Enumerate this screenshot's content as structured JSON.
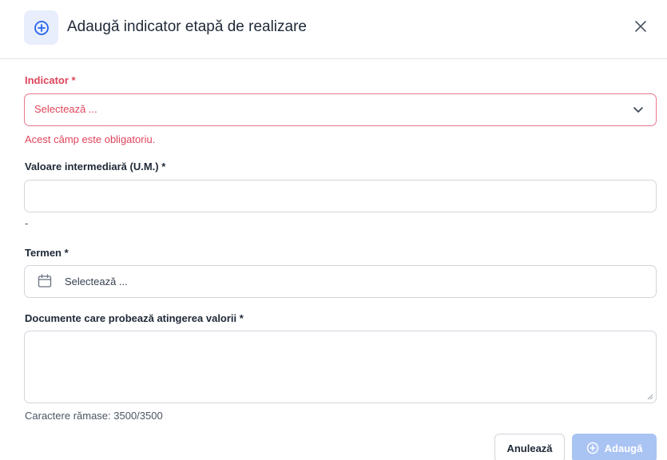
{
  "dialog": {
    "title": "Adaugă indicator etapă de realizare",
    "icon": "plus-circle-icon",
    "close_icon": "close-icon"
  },
  "form": {
    "indicator": {
      "label": "Indicator *",
      "placeholder": "Selectează ...",
      "error": "Acest câmp este obligatoriu."
    },
    "valoare": {
      "label": "Valoare intermediară (U.M.) *",
      "value": "",
      "hint": "-"
    },
    "termen": {
      "label": "Termen *",
      "placeholder": "Selectează ..."
    },
    "documente": {
      "label": "Documente care probează atingerea valorii *",
      "value": "",
      "counter": "Caractere rămase: 3500/3500"
    }
  },
  "footer": {
    "cancel_label": "Anulează",
    "add_label": "Adaugă"
  },
  "colors": {
    "error": "#e0445b",
    "primary_disabled": "#a9c3f3",
    "icon_bg": "#e8eefc",
    "icon_blue": "#2563eb"
  }
}
